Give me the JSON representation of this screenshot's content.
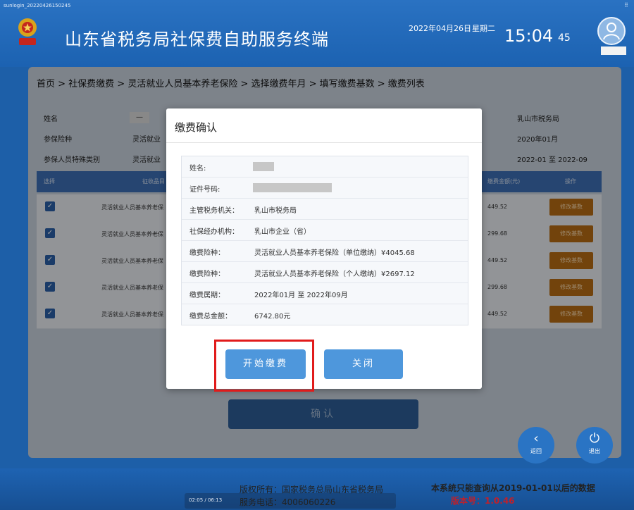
{
  "header": {
    "session_id": "sunlogin_20220426150245",
    "app_title": "山东省税务局社保费自助服务终端",
    "date": "2022年04月26日",
    "weekday": "星期二",
    "time_hm": "15:04",
    "time_s": "45"
  },
  "breadcrumb": "首页 > 社保费缴费 > 灵活就业人员基本养老保险 > 选择缴费年月 > 填写缴费基数 > 缴费列表",
  "info": {
    "name_label": "姓名",
    "name_value": "—",
    "insurance_label": "参保险种",
    "insurance_value": "灵活就业",
    "category_label": "参保人员特殊类别",
    "category_value": "灵活就业",
    "tax_office": "乳山市税务局",
    "start_month": "2020年01月",
    "period": "2022-01 至 2022-09"
  },
  "grid": {
    "headers": [
      "选择",
      "征收品目",
      "缴费金额(元)",
      "操作"
    ],
    "rows": [
      {
        "name": "灵活就业人员基本养老保",
        "amount": "449.52",
        "action": "修改基数"
      },
      {
        "name": "灵活就业人员基本养老保",
        "amount": "299.68",
        "action": "修改基数"
      },
      {
        "name": "灵活就业人员基本养老保",
        "amount": "449.52",
        "action": "修改基数"
      },
      {
        "name": "灵活就业人员基本养老保",
        "amount": "299.68",
        "action": "修改基数"
      },
      {
        "name": "灵活就业人员基本养老保",
        "amount": "449.52",
        "action": "修改基数"
      }
    ]
  },
  "confirm_label": "确认",
  "back_label": "返回",
  "exit_label": "退出",
  "footer": {
    "copyright": "版权所有：国家税务总局山东省税务局",
    "hotline": "服务电话：4006060226",
    "notice": "本系统只能查询从2019-01-01以后的数据",
    "version": "版本号：1.0.46",
    "video_time": "02:05 / 06:13"
  },
  "modal": {
    "title": "缴费确认",
    "rows": [
      {
        "key": "姓名:",
        "value": ""
      },
      {
        "key": "证件号码:",
        "value": ""
      },
      {
        "key": "主管税务机关：",
        "value": "乳山市税务局"
      },
      {
        "key": "社保经办机构：",
        "value": "乳山市企业（省）"
      },
      {
        "key": "缴费险种：",
        "value": "灵活就业人员基本养老保险（单位缴纳）¥4045.68"
      },
      {
        "key": "缴费险种：",
        "value": "灵活就业人员基本养老保险（个人缴纳）¥2697.12"
      },
      {
        "key": "缴费属期：",
        "value": "2022年01月 至 2022年09月"
      },
      {
        "key": "缴费总金额：",
        "value": "6742.80元"
      }
    ],
    "pay_button": "开始缴费",
    "close_button": "关闭"
  },
  "colors": {
    "header_blue": "#1c62b1",
    "primary_button": "#4e97dc",
    "highlight_red": "#e11b1b",
    "action_orange": "#b86c14",
    "version_red": "#c0202a"
  }
}
